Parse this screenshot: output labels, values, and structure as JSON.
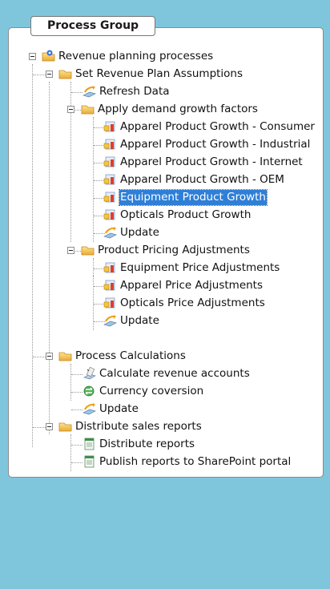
{
  "process_group": {
    "title": "Process Group"
  },
  "tree": {
    "root": "Revenue planning processes",
    "set_assumptions": "Set Revenue Plan Assumptions",
    "refresh_data": "Refresh Data",
    "apply_demand": "Apply demand growth factors",
    "apparel_consumer": "Apparel Product Growth - Consumer",
    "apparel_industrial": "Apparel Product Growth - Industrial",
    "apparel_internet": "Apparel Product Growth - Internet",
    "apparel_oem": "Apparel Product Growth - OEM",
    "equipment_growth": "Equipment Product Growth",
    "opticals_growth": "Opticals Product Growth",
    "update1": "Update",
    "pricing_adjustments": "Product Pricing Adjustments",
    "equipment_price": "Equipment Price Adjustments",
    "apparel_price": "Apparel Price Adjustments",
    "opticals_price": "Opticals Price Adjustments",
    "update2": "Update",
    "process_calculations": "Process Calculations",
    "calc_revenue": "Calculate revenue accounts",
    "currency_conversion": "Currency coversion",
    "update3": "Update",
    "distribute_sales": "Distribute sales reports",
    "distribute_reports": "Distribute reports",
    "publish_reports": "Publish reports to SharePoint portal"
  },
  "selected_item": "Equipment Product Growth",
  "colors": {
    "background": "#7fc6dd",
    "accent_arc": "#e3241b",
    "selection": "#2f7fd7"
  }
}
